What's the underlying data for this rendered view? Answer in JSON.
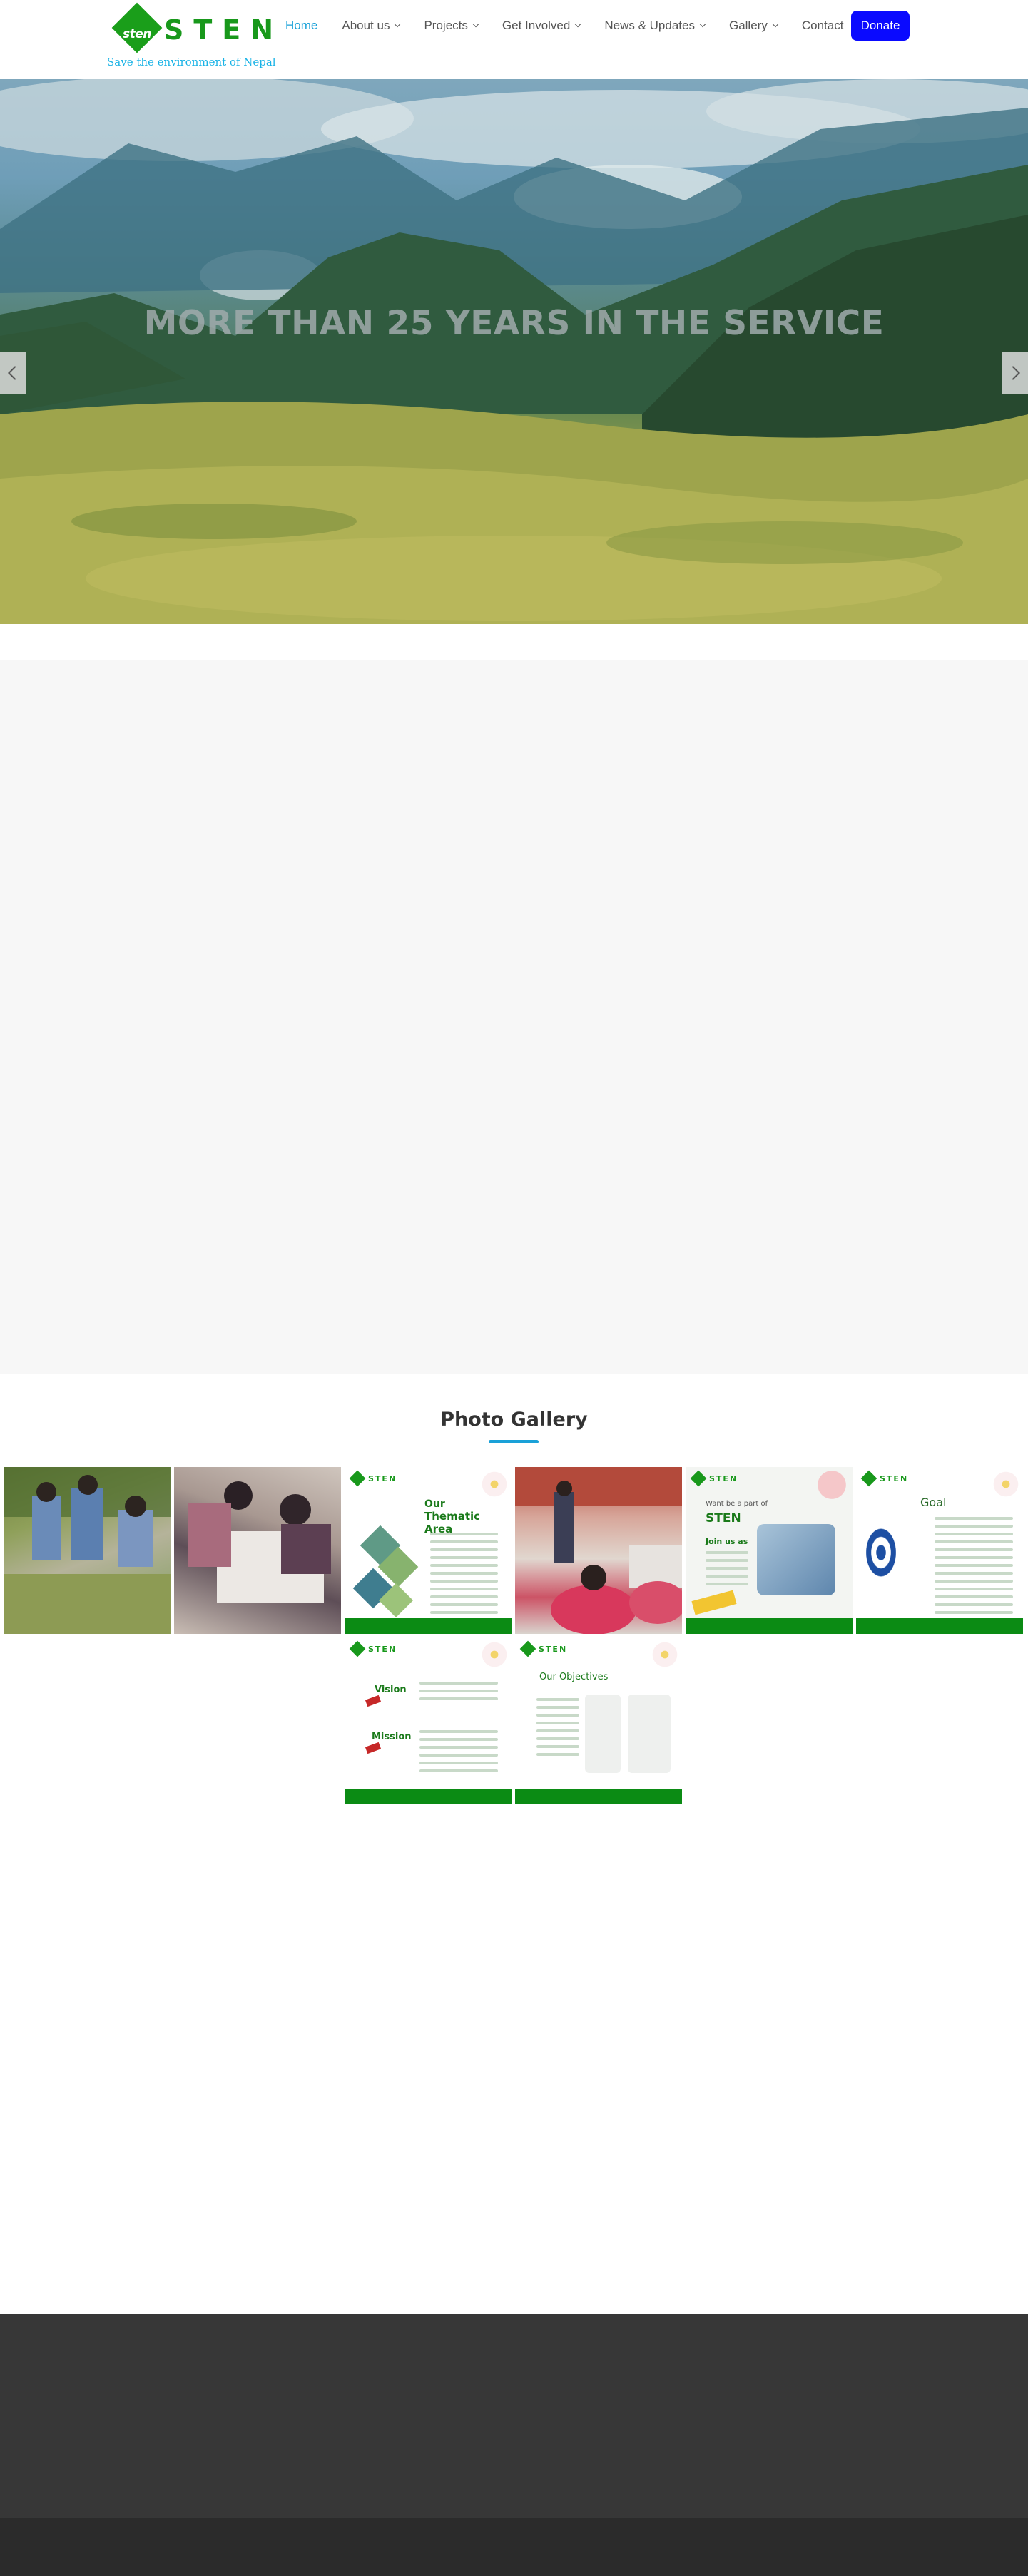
{
  "brand": {
    "logo_small": "sten",
    "logo_word": "STEN",
    "tagline": "Save the environment of Nepal",
    "color": "#18981b"
  },
  "nav": {
    "items": [
      {
        "label": "Home",
        "active": true
      },
      {
        "label": "About us",
        "dropdown": true
      },
      {
        "label": "Projects",
        "dropdown": true
      },
      {
        "label": "Get Involved",
        "dropdown": true
      },
      {
        "label": "News & Updates",
        "dropdown": true
      },
      {
        "label": "Gallery",
        "dropdown": true
      },
      {
        "label": "Contact"
      }
    ],
    "donate_label": "Donate",
    "active_color": "#1aa1d8",
    "donate_color": "#0a0aff"
  },
  "hero": {
    "title": "MORE THAN 25 YEARS IN THE SERVICE",
    "prev_icon": "chevron-left-icon",
    "next_icon": "chevron-right-icon"
  },
  "gallery": {
    "title": "Photo Gallery",
    "accent": "#1aa1d8",
    "posters": {
      "brand": "STEN",
      "thematic_title_1": "Our",
      "thematic_title_2": "Thematic Area",
      "join_title_1": "Want be a part of",
      "join_title_2": "STEN",
      "join_title_3": "Join us as",
      "goal_title": "Goal",
      "vision": "Vision",
      "mission": "Mission",
      "objectives_title": "Our Objectives"
    }
  },
  "footer": {
    "top_color": "#373737",
    "bottom_color": "#2b2b2b"
  }
}
